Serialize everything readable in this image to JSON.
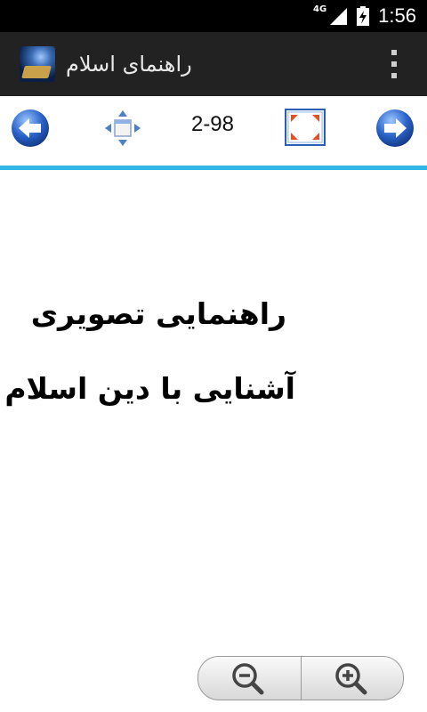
{
  "status_bar": {
    "network_label": "4G",
    "time": "1:56"
  },
  "action_bar": {
    "title": "راهنمای اسلام"
  },
  "toolbar": {
    "page_counter": "2-98"
  },
  "content": {
    "line1": "راهنمایی تصویری",
    "line2": "آشنایی با دین اسلام"
  },
  "colors": {
    "accent": "#33b5e5",
    "action_bar_bg": "#222222",
    "arrow_blue": "#2a63c9"
  },
  "icons": {
    "prev": "arrow-left-icon",
    "move": "move-arrows-icon",
    "fullscreen": "fullscreen-icon",
    "next": "arrow-right-icon",
    "zoom_out": "zoom-out-icon",
    "zoom_in": "zoom-in-icon"
  }
}
